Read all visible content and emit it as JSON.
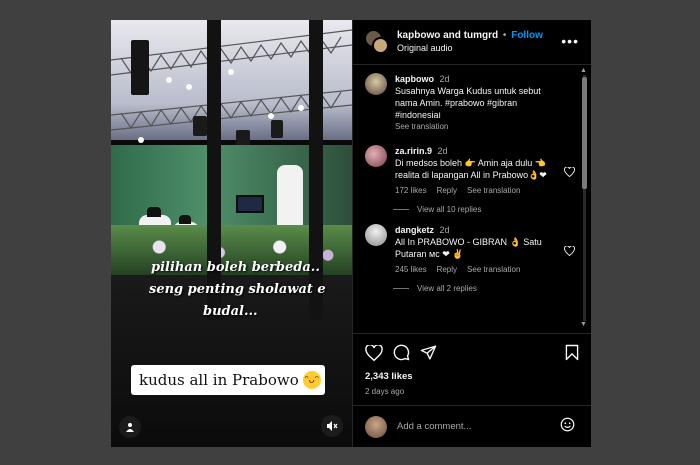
{
  "video": {
    "overlay_lines": [
      "pilihan boleh berbeda..",
      "seng penting sholawat e",
      "budal..."
    ],
    "sticker_text": "kudus all in Prabowo",
    "sticker_emoji": "grinning-face-emoji",
    "user_icon": "user-icon",
    "mute_icon": "mute-icon"
  },
  "header": {
    "author": "kapbowo",
    "and_text": "and",
    "coauthor": "tumgrd",
    "separator": "•",
    "follow_label": "Follow",
    "audio": "Original audio",
    "more_icon": "more-icon"
  },
  "comments": [
    {
      "user": "kapbowo",
      "time": "2d",
      "text": "Susahnya Warga Kudus untuk sebut nama Amin. #prabowo #gibran #indonesiaו",
      "see_translation": "See translation"
    },
    {
      "user": "za.ririn.9",
      "time": "2d",
      "text": "Di medsos boleh 👉 Amin aja dulu 👈 realita di lapangan All in Prabowo👌❤",
      "likes": "172 likes",
      "reply": "Reply",
      "see_translation": "See translation",
      "view_replies": "View all 10 replies"
    },
    {
      "user": "dangketz",
      "time": "2d",
      "text": "All In PRABOWO - GIBRAN 👌 Satu Putaran ᴍᴄ ❤ ✌",
      "likes": "245 likes",
      "reply": "Reply",
      "see_translation": "See translation",
      "view_replies": "View all 2 replies"
    }
  ],
  "actions": {
    "like_icon": "heart-icon",
    "comment_icon": "comment-icon",
    "share_icon": "share-icon",
    "save_icon": "bookmark-icon"
  },
  "likes": "2,343 likes",
  "date": "2 days ago",
  "add_comment_placeholder": "Add a comment...",
  "colors": {
    "follow": "#0095f6",
    "background": "#000000",
    "muted_text": "#a8a8a8"
  }
}
